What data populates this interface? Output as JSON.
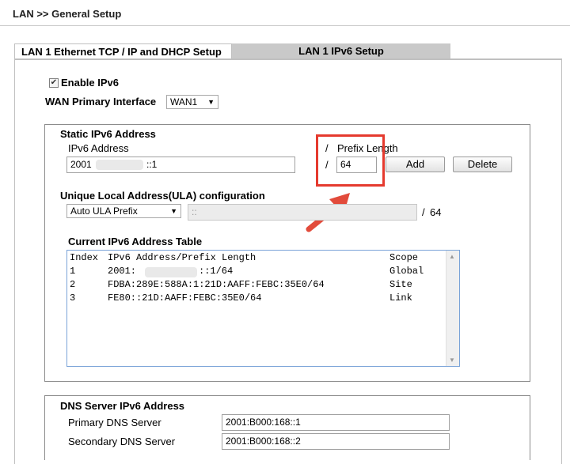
{
  "page": {
    "title": "LAN >> General Setup"
  },
  "tabs": [
    {
      "label": "LAN 1 Ethernet TCP / IP and DHCP Setup"
    },
    {
      "label": "LAN 1 IPv6 Setup"
    }
  ],
  "enable_ipv6": {
    "label": "Enable IPv6",
    "checked": true
  },
  "wan_primary": {
    "label": "WAN Primary Interface",
    "value": "WAN1"
  },
  "static": {
    "heading": "Static IPv6 Address",
    "address_label": "IPv6 Address",
    "address_prefix": "2001",
    "address_suffix": "::1",
    "slash": "/",
    "prefix_label": "Prefix Length",
    "prefix_value": "64",
    "add_label": "Add",
    "delete_label": "Delete"
  },
  "ula": {
    "heading": "Unique Local Address(ULA) configuration",
    "mode": "Auto ULA Prefix",
    "prefix_value": "::",
    "slash": "/",
    "length": "64"
  },
  "table": {
    "heading": "Current IPv6 Address Table",
    "columns": [
      "Index",
      "IPv6 Address/Prefix Length",
      "Scope"
    ],
    "rows": [
      {
        "index": "1",
        "address_prefix": "2001:",
        "address_suffix": "::1/64",
        "scope": "Global"
      },
      {
        "index": "2",
        "address": "FDBA:289E:588A:1:21D:AAFF:FEBC:35E0/64",
        "scope": "Site"
      },
      {
        "index": "3",
        "address": "FE80::21D:AAFF:FEBC:35E0/64",
        "scope": "Link"
      }
    ]
  },
  "dns": {
    "heading": "DNS Server IPv6 Address",
    "primary_label": "Primary DNS Server",
    "primary_value": "2001:B000:168::1",
    "secondary_label": "Secondary DNS Server",
    "secondary_value": "2001:B000:168::2"
  },
  "colors": {
    "highlight": "#e53a2e",
    "arrow": "#e24b3b",
    "active_tab": "#c9c9c9"
  }
}
